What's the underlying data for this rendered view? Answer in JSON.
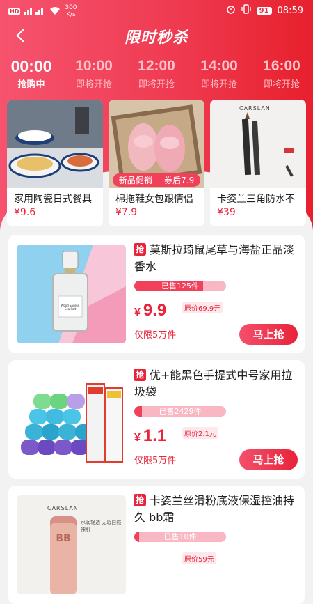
{
  "status_bar": {
    "left": "HD",
    "speed": "300",
    "speed_unit": "K/s",
    "battery": "91",
    "time": "08:59"
  },
  "header": {
    "title": "限时秒杀"
  },
  "time_slots": [
    {
      "time": "00:00",
      "status": "抢购中",
      "active": true
    },
    {
      "time": "10:00",
      "status": "即将开抢"
    },
    {
      "time": "12:00",
      "status": "即将开抢"
    },
    {
      "time": "14:00",
      "status": "即将开抢"
    },
    {
      "time": "16:00",
      "status": "即将开抢"
    }
  ],
  "featured": [
    {
      "name": "家用陶瓷日式餐具",
      "price": "¥9.6"
    },
    {
      "name": "棉拖鞋女包跟情侣",
      "price": "¥7.9",
      "badge_left": "新品促销",
      "badge_right": "券后7.9"
    },
    {
      "name": "卡姿兰三角防水不",
      "price": "¥39",
      "brand": "CARSLAN"
    }
  ],
  "products": [
    {
      "tag": "抢",
      "name": "莫斯拉琦鼠尾草与海盐正品淡香水",
      "sold": "已售125件",
      "sold_ratio": 0.75,
      "currency": "¥",
      "price": "9.9",
      "original": "原价69.9元",
      "limit": "仅限5万件",
      "buy": "马上抢",
      "bottle_label": "Wood Sage & Sea Salt"
    },
    {
      "tag": "抢",
      "name": "优+能黑色手提式中号家用拉圾袋",
      "sold": "已售2429件",
      "sold_ratio": 0.08,
      "currency": "¥",
      "price": "1.1",
      "original": "原价2.1元",
      "limit": "仅限5万件",
      "buy": "马上抢"
    },
    {
      "tag": "抢",
      "name": "卡姿兰丝滑粉底液保湿控油持久 bb霜",
      "sold": "已售10件",
      "sold_ratio": 0.05,
      "original": "原价59元",
      "brand": "CARSLAN",
      "slogan": "水润轻透 无瑕自然裸肌",
      "product_mark": "BB"
    }
  ]
}
